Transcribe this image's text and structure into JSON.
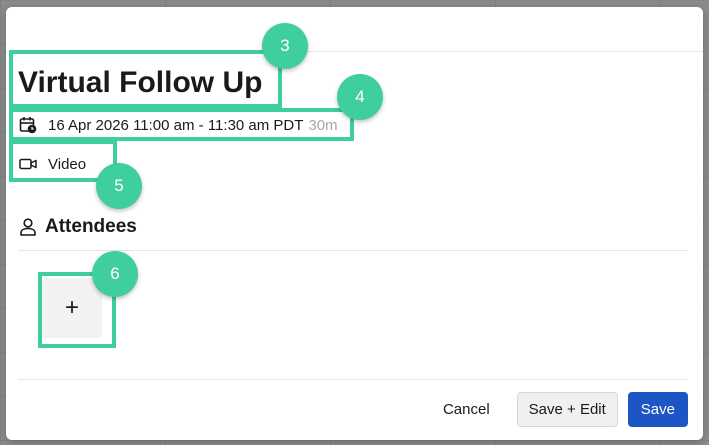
{
  "event": {
    "title": "Virtual Follow Up",
    "datetime": "16 Apr 2026 11:00 am - 11:30 am PDT",
    "duration": "30m",
    "location_type": "Video"
  },
  "attendees": {
    "header": "Attendees",
    "add_label": "+"
  },
  "footer": {
    "cancel_label": "Cancel",
    "save_edit_label": "Save + Edit",
    "save_label": "Save"
  },
  "annotations": [
    "3",
    "4",
    "5",
    "6"
  ],
  "colors": {
    "primary_button": "#1b56c4",
    "annotation": "#3ecf9c",
    "duration_text": "#a8a8a8"
  },
  "icons": {
    "date": "calendar-clock-icon",
    "video": "video-camera-icon",
    "attendees": "person-icon"
  }
}
